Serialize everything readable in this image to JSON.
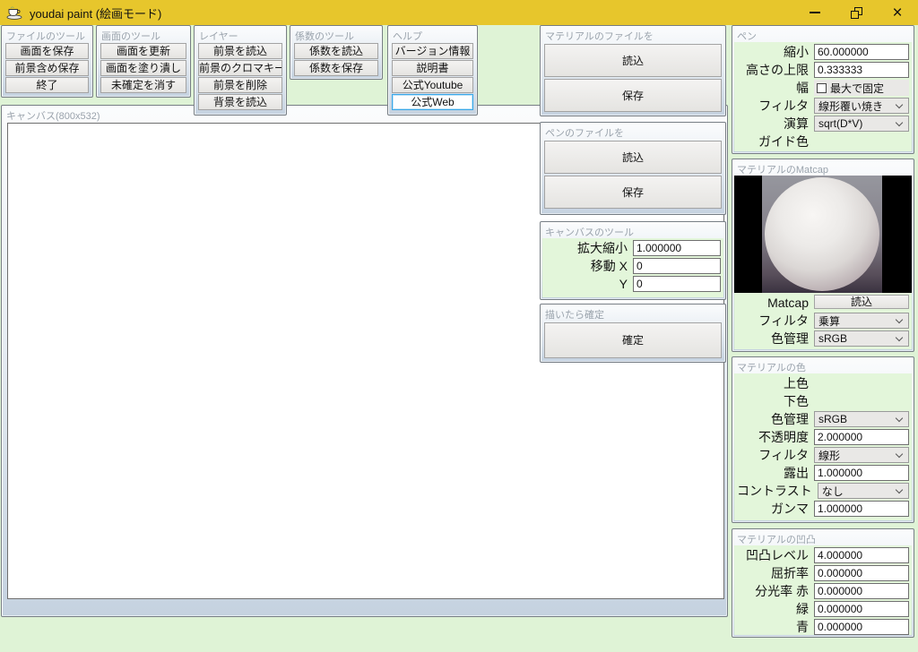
{
  "window": {
    "title": "youdai paint (絵画モード)",
    "close_glyph": "×"
  },
  "colors": {
    "titlebar": "#e7c62c",
    "background": "#dff3d6",
    "panel_green": "#e3f6da",
    "guide_color": "#ff0000",
    "top_color": "#ffffff",
    "bottom_color": "#ffffff"
  },
  "file_tools": {
    "title": "ファイルのツール",
    "buttons": [
      "画面を保存",
      "前景含め保存",
      "終了"
    ]
  },
  "screen_tools": {
    "title": "画面のツール",
    "buttons": [
      "画面を更新",
      "画面を塗り潰し",
      "未確定を消す"
    ]
  },
  "layer": {
    "title": "レイヤー",
    "buttons": [
      "前景を読込",
      "前景のクロマキー",
      "前景を削除",
      "背景を読込"
    ]
  },
  "coef_tools": {
    "title": "係数のツール",
    "buttons": [
      "係数を読込",
      "係数を保存"
    ]
  },
  "help": {
    "title": "ヘルプ",
    "buttons": [
      "バージョン情報",
      "説明書",
      "公式Youtube",
      "公式Web"
    ]
  },
  "canvas": {
    "title": "キャンバス(800x532)"
  },
  "material_file": {
    "title": "マテリアルのファイルを",
    "load": "読込",
    "save": "保存"
  },
  "pen_file": {
    "title": "ペンのファイルを",
    "load": "読込",
    "save": "保存"
  },
  "canvas_tools": {
    "title": "キャンバスのツール",
    "zoom_label": "拡大縮小",
    "zoom_value": "1.000000",
    "move_x_label": "移動 X",
    "move_x_value": "0",
    "move_y_label": "Y",
    "move_y_value": "0"
  },
  "confirm": {
    "title": "描いたら確定",
    "button": "確定"
  },
  "pen": {
    "title": "ペン",
    "shrink_label": "縮小",
    "shrink_value": "60.000000",
    "height_label": "高さの上限",
    "height_value": "0.333333",
    "width_label": "幅",
    "width_checkbox": "最大で固定",
    "filter_label": "フィルタ",
    "filter_value": "線形覆い焼き",
    "op_label": "演算",
    "op_value": "sqrt(D*V)",
    "guide_label": "ガイド色"
  },
  "matcap": {
    "title": "マテリアルのMatcap",
    "matcap_label": "Matcap",
    "load": "読込",
    "filter_label": "フィルタ",
    "filter_value": "乗算",
    "cm_label": "色管理",
    "cm_value": "sRGB"
  },
  "material_color": {
    "title": "マテリアルの色",
    "top_label": "上色",
    "bottom_label": "下色",
    "cm_label": "色管理",
    "cm_value": "sRGB",
    "opacity_label": "不透明度",
    "opacity_value": "2.000000",
    "filter_label": "フィルタ",
    "filter_value": "線形",
    "exposure_label": "露出",
    "exposure_value": "1.000000",
    "contrast_label": "コントラスト",
    "contrast_value": "なし",
    "gamma_label": "ガンマ",
    "gamma_value": "1.000000"
  },
  "material_bump": {
    "title": "マテリアルの凹凸",
    "level_label": "凹凸レベル",
    "level_value": "4.000000",
    "refraction_label": "屈折率",
    "refraction_value": "0.000000",
    "spectral_r_label": "分光率 赤",
    "spectral_r_value": "0.000000",
    "spectral_g_label": "緑",
    "spectral_g_value": "0.000000",
    "spectral_b_label": "青",
    "spectral_b_value": "0.000000"
  }
}
